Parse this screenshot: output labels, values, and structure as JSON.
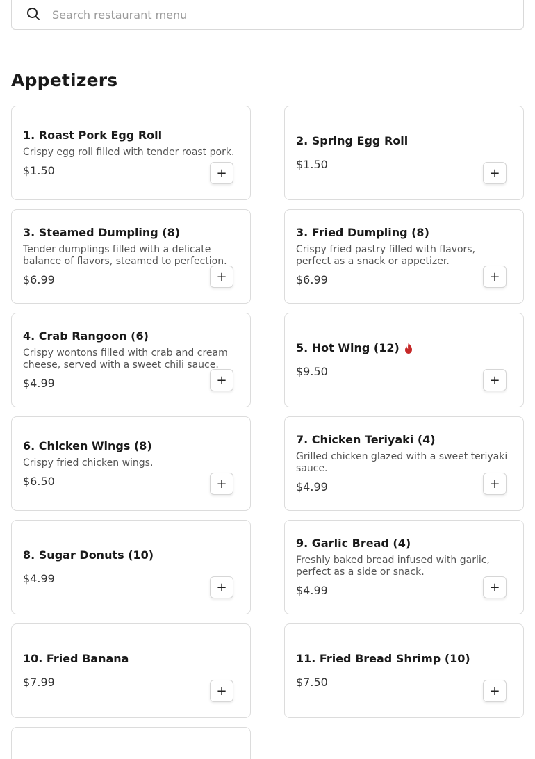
{
  "search": {
    "placeholder": "Search restaurant menu",
    "icon": "search-icon"
  },
  "section": {
    "title": "Appetizers"
  },
  "items": [
    {
      "name": "1. Roast Pork Egg Roll",
      "desc": "Crispy egg roll filled with tender roast pork.",
      "price": "$1.50",
      "add": "+"
    },
    {
      "name": "2. Spring Egg Roll",
      "desc": "",
      "price": "$1.50",
      "add": "+"
    },
    {
      "name": "3. Steamed Dumpling (8)",
      "desc": "Tender dumplings filled with a delicate balance of flavors, steamed to perfection.",
      "price": "$6.99",
      "add": "+"
    },
    {
      "name": "3. Fried Dumpling (8)",
      "desc": "Crispy fried pastry filled with flavors, perfect as a snack or appetizer.",
      "price": "$6.99",
      "add": "+"
    },
    {
      "name": "4. Crab Rangoon (6)",
      "desc": "Crispy wontons filled with crab and cream cheese, served with a sweet chili sauce.",
      "price": "$4.99",
      "add": "+"
    },
    {
      "name": "5. Hot Wing (12)",
      "desc": "",
      "price": "$9.50",
      "add": "+",
      "spicy": true
    },
    {
      "name": "6. Chicken Wings (8)",
      "desc": "Crispy fried chicken wings.",
      "price": "$6.50",
      "add": "+"
    },
    {
      "name": "7. Chicken Teriyaki (4)",
      "desc": "Grilled chicken glazed with a sweet teriyaki sauce.",
      "price": "$4.99",
      "add": "+"
    },
    {
      "name": "8. Sugar Donuts (10)",
      "desc": "",
      "price": "$4.99",
      "add": "+"
    },
    {
      "name": "9. Garlic Bread (4)",
      "desc": "Freshly baked bread infused with garlic, perfect as a side or snack.",
      "price": "$4.99",
      "add": "+"
    },
    {
      "name": "10. Fried Banana",
      "desc": "",
      "price": "$7.99",
      "add": "+"
    },
    {
      "name": "11. Fried Bread Shrimp (10)",
      "desc": "",
      "price": "$7.50",
      "add": "+"
    }
  ],
  "colors": {
    "spicy": "#c62828",
    "border": "#dcdcdc"
  }
}
